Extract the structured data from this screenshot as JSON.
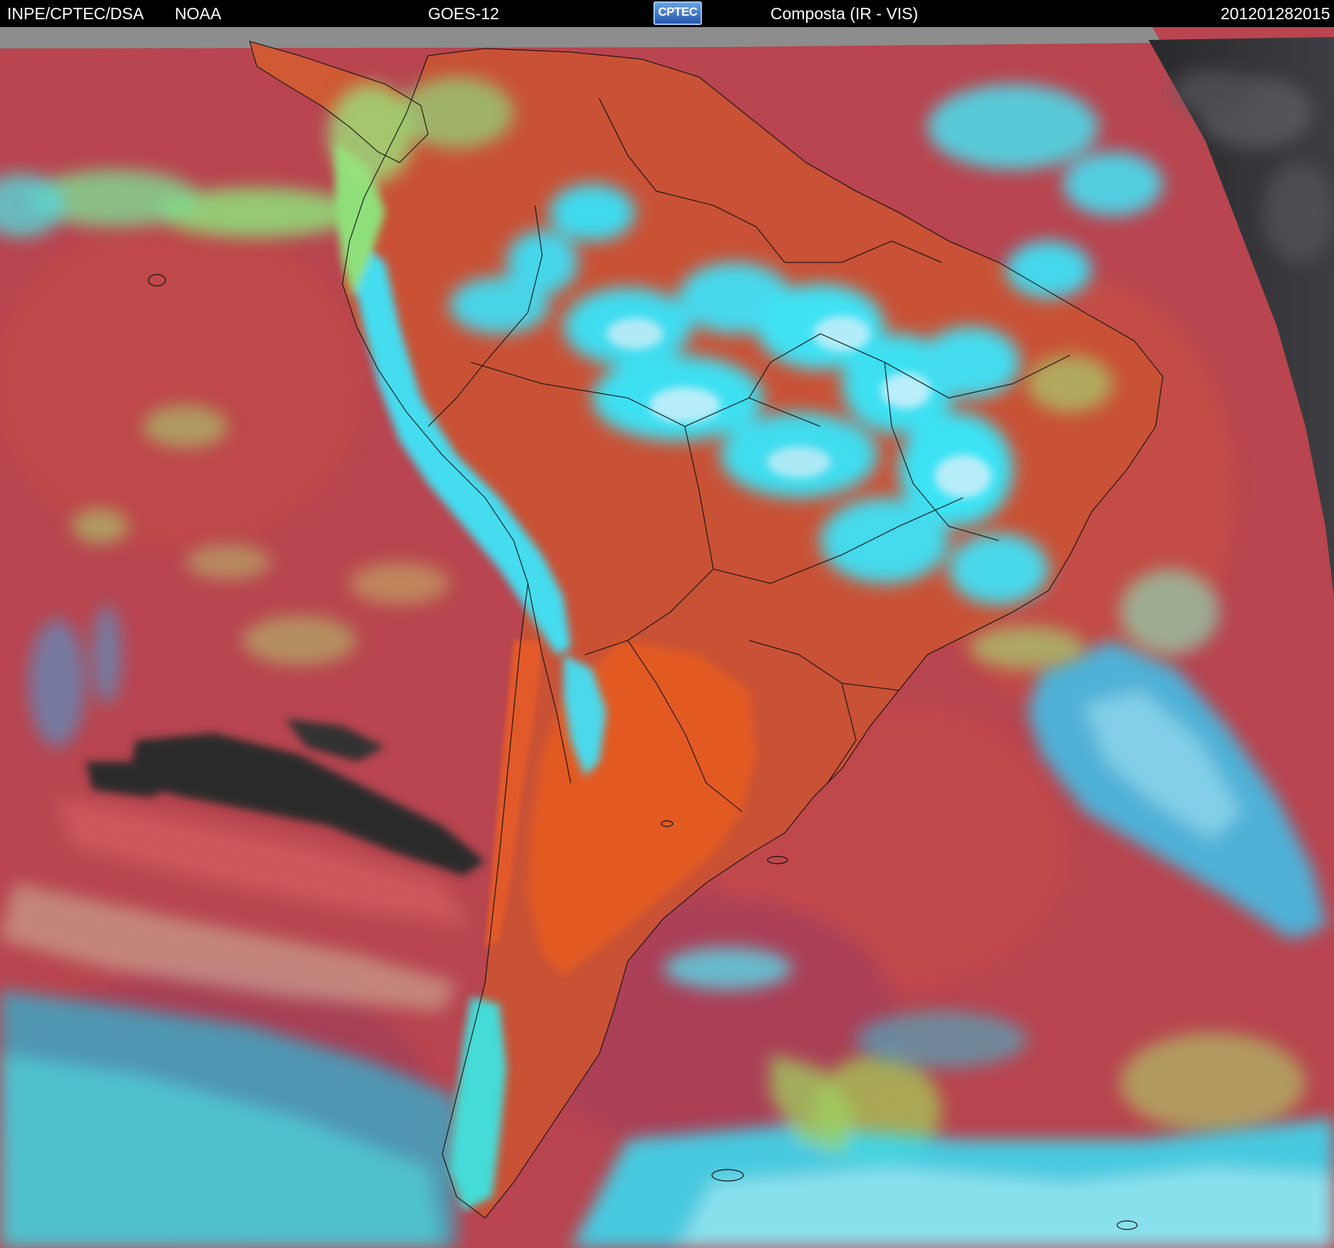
{
  "header": {
    "agency": "INPE/CPTEC/DSA",
    "partner": "NOAA",
    "satellite": "GOES-12",
    "logo_text": "CPTEC",
    "product": "Composta (IR - VIS)",
    "timestamp": "201201282015"
  },
  "colors": {
    "header_bg": "#000000",
    "header_text": "#ffffff",
    "clear_ocean": "#b8454f",
    "clear_land": "#d9562e",
    "high_cloud": "#39e4f2",
    "mid_cloud": "#8fe07a",
    "no_data_gray": "#8d8d8d",
    "night_side": "#333336"
  }
}
